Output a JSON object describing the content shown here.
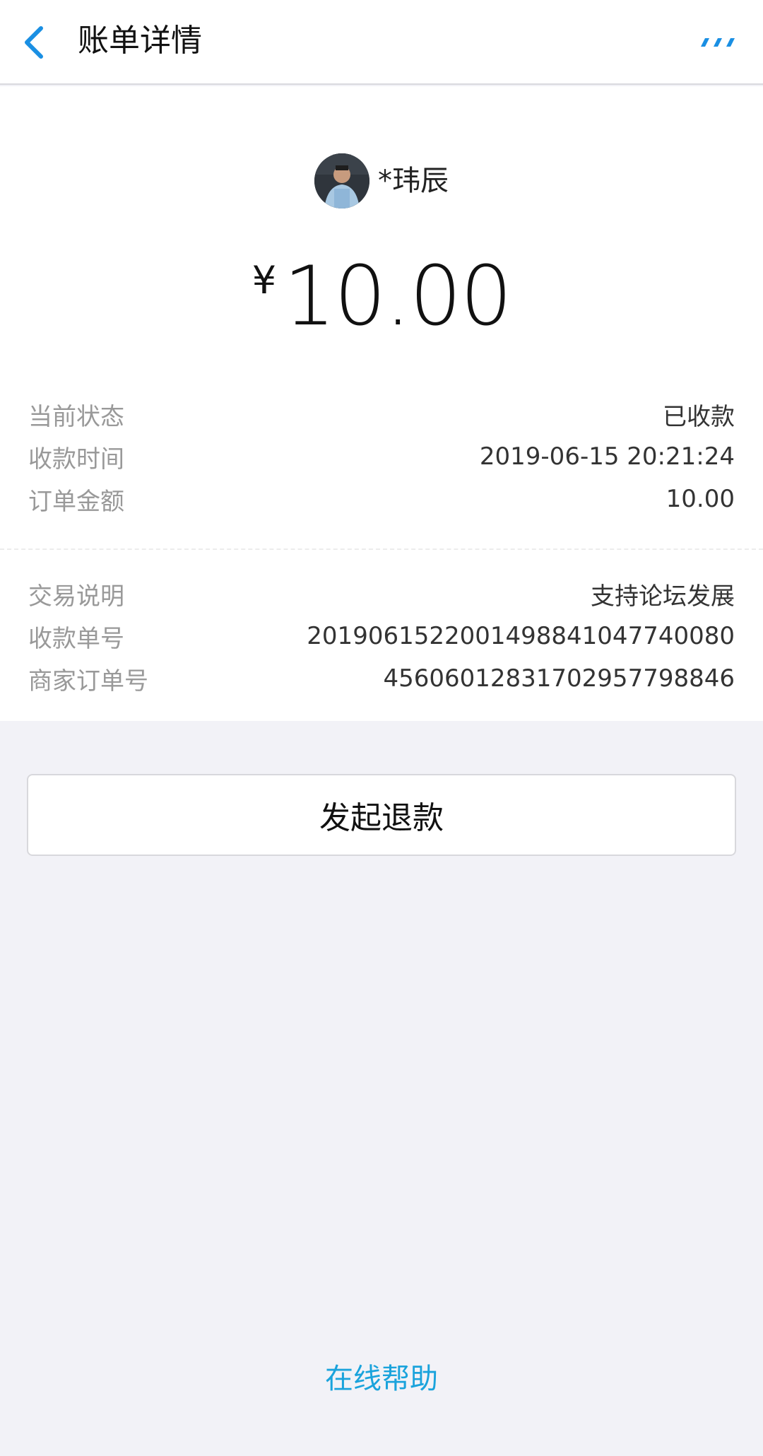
{
  "header": {
    "title": "账单详情",
    "back_icon": "chevron-left-icon",
    "more_icon": "more-dots-icon",
    "accent_color": "#1a8fe3"
  },
  "payer": {
    "name": "*玮辰",
    "avatar": "user-avatar"
  },
  "amount": {
    "currency": "¥",
    "value": "10.00"
  },
  "details": [
    {
      "label": "当前状态",
      "value": "已收款"
    },
    {
      "label": "收款时间",
      "value": "2019-06-15 20:21:24"
    },
    {
      "label": "订单金额",
      "value": "10.00"
    },
    {
      "label": "交易说明",
      "value": "支持论坛发展"
    },
    {
      "label": "收款单号",
      "value": "2019061522001498841047740080"
    },
    {
      "label": "商家订单号",
      "value": "4560601283170295779884­6"
    }
  ],
  "actions": {
    "refund_label": "发起退款"
  },
  "footer": {
    "help_label": "在线帮助",
    "help_color": "#1aa3dc"
  }
}
